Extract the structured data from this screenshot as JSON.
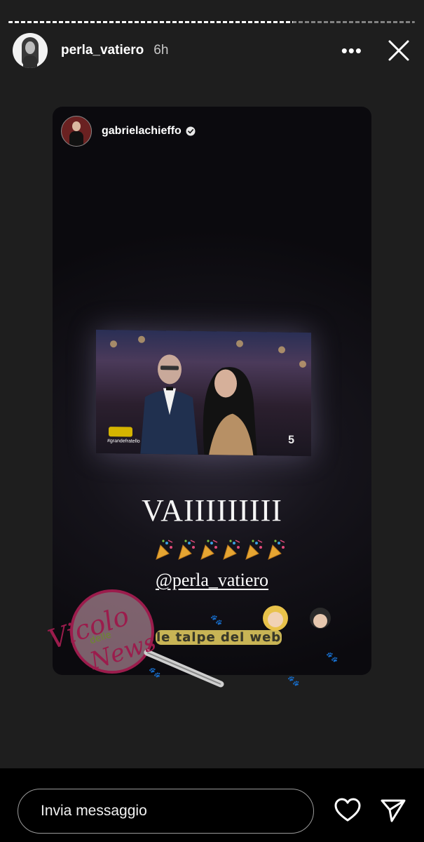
{
  "story": {
    "progress": 0.7,
    "user": {
      "username": "perla_vatiero",
      "time": "6h"
    }
  },
  "shared_post": {
    "username": "gabrielachieffo",
    "verified": true,
    "tv_overlay": {
      "hashtag": "#grandefratello",
      "channel": "5"
    },
    "caption": "VAIIIIIIIII",
    "emoji_count": 6,
    "mention": "@perla_vatiero"
  },
  "watermarks": {
    "left": "Vicolo delle News",
    "right": "le talpe del web"
  },
  "footer": {
    "message_placeholder": "Invia messaggio"
  },
  "icons": [
    "more-icon",
    "close-icon",
    "verified-icon",
    "party-popper-icon",
    "heart-icon",
    "send-icon"
  ]
}
